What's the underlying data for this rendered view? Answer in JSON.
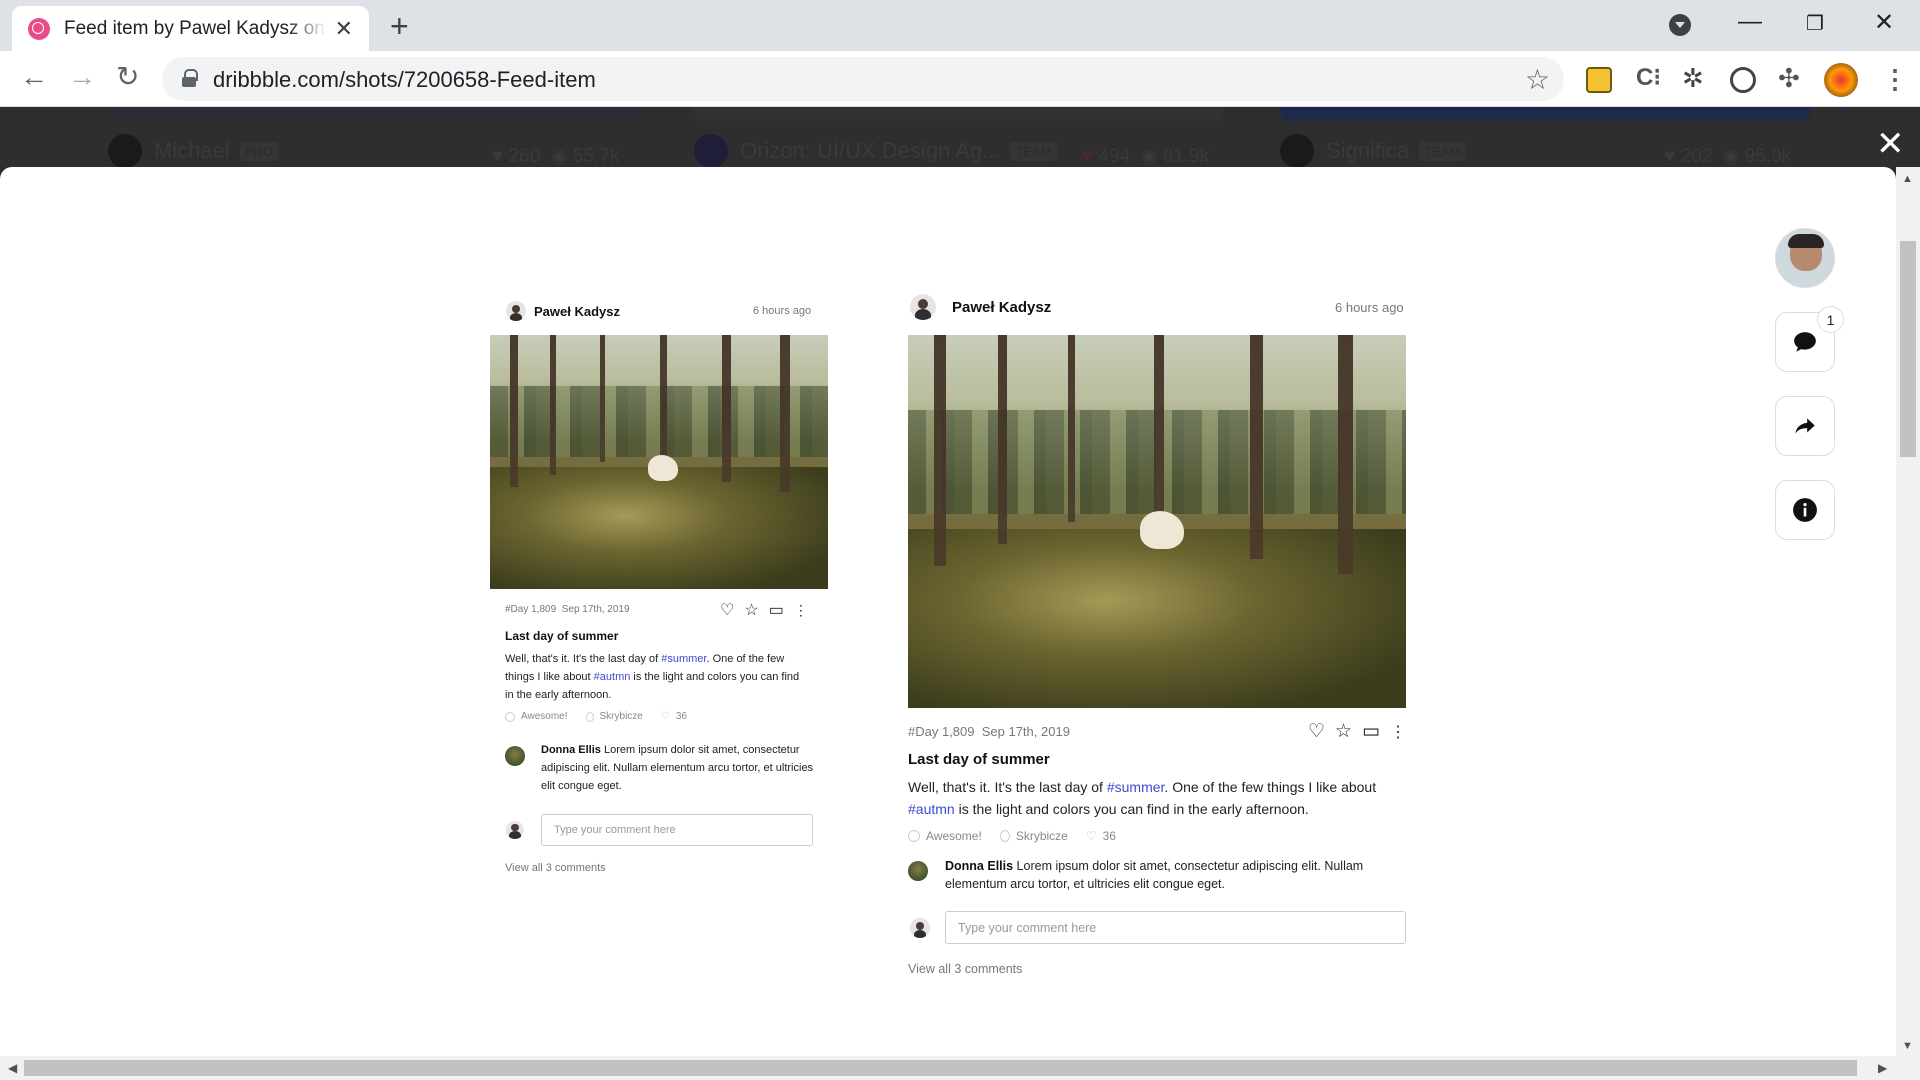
{
  "browser": {
    "tab_title": "Feed item by Pawel Kadysz on Dribbble",
    "url": "dribbble.com/shots/7200658-Feed-item"
  },
  "background_shots": [
    {
      "name": "Michael",
      "tag": "PRO",
      "likes": "260",
      "views": "55.7k"
    },
    {
      "name": "Orizon: UI/UX Design Ag...",
      "tag": "TEAM",
      "likes": "494",
      "views": "81.9k"
    },
    {
      "name": "Significa",
      "tag": "TEAM",
      "likes": "202",
      "views": "95.9k"
    }
  ],
  "post": {
    "author": "Paweł Kadysz",
    "time": "6 hours ago",
    "day": "#Day 1,809",
    "date": "Sep 17th, 2019",
    "title": "Last day of summer",
    "body_1": "Well, that's it. It's the last day of ",
    "hashtag_1": "#summer",
    "body_2": ". One of the few things I like about ",
    "hashtag_2": "#autmn",
    "body_3": " is the light and colors you can find in the early afternoon.",
    "feeling": "Awesome!",
    "location": "Skrybicze",
    "likes": "36",
    "comment_author": "Donna Ellis",
    "comment_text": " Lorem ipsum dolor sit amet, consectetur adipiscing elit. Nullam elementum arcu tortor, et ultricies elit congue eget.",
    "input_placeholder": "Type your comment here",
    "view_all": "View all 3 comments"
  },
  "sidebar": {
    "comment_count": "1"
  },
  "colors": {
    "dribbble_pink": "#ea4c89",
    "hashtag": "#3a4bd2"
  }
}
